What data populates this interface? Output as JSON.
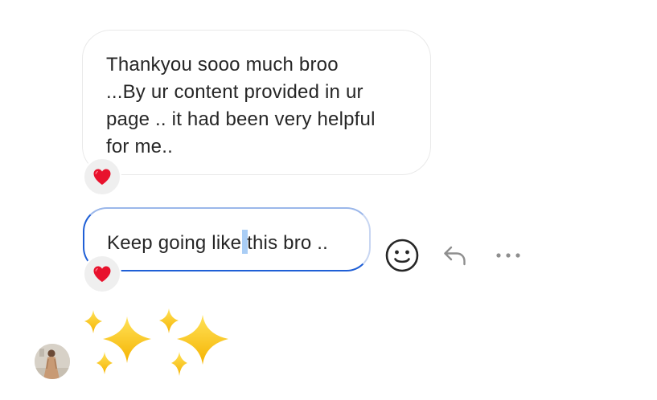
{
  "messages": [
    {
      "lines": [
        "Thankyou sooo much broo",
        "...By ur content provided in ur",
        "page .. it had been very helpful",
        "for me.."
      ],
      "reaction": "heart-icon"
    },
    {
      "text_before_cursor": "Keep going like",
      "text_after_cursor": "this bro ..",
      "reaction": "heart-icon"
    }
  ],
  "sticker": "sparkles-emoji",
  "actions": [
    "emoji-react-icon",
    "reply-icon",
    "more-options-icon"
  ],
  "colors": {
    "bubble_border": "#e9e9e9",
    "selected_border": "#1f5fd6",
    "cursor_highlight": "#a9cdf5",
    "heart": "#e8122d",
    "reaction_bg": "#efefef",
    "text": "#262626",
    "icon_grey": "#8e8e8e"
  }
}
